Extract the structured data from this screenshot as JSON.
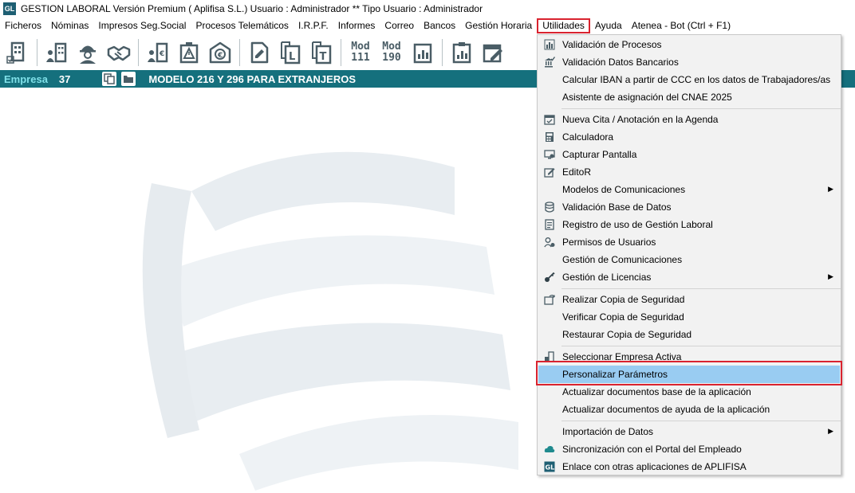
{
  "window": {
    "app_icon_text": "GL",
    "title": "GESTION LABORAL Versión Premium ( Aplifisa S.L.)   Usuario : Administrador  **  Tipo Usuario : Administrador"
  },
  "menubar": {
    "items": [
      "Ficheros",
      "Nóminas",
      "Impresos Seg.Social",
      "Procesos Telemáticos",
      "I.R.P.F.",
      "Informes",
      "Correo",
      "Bancos",
      "Gestión Horaria",
      "Utilidades",
      "Ayuda",
      "Atenea - Bot (Ctrl + F1)"
    ],
    "active": "Utilidades"
  },
  "toolbar": {
    "mod111_top": "Mod",
    "mod111_bottom": "111",
    "mod190_top": "Mod",
    "mod190_bottom": "190"
  },
  "empresa_bar": {
    "label": "Empresa",
    "number": "37",
    "modelo": "MODELO 216 Y 296 PARA EXTRANJEROS"
  },
  "utilidades_menu": {
    "items": [
      "Validación de Procesos",
      "Validación Datos Bancarios",
      "Calcular IBAN a partir de CCC en los datos de Trabajadores/as",
      "Asistente de asignación del CNAE 2025",
      "Nueva Cita / Anotación en la Agenda",
      "Calculadora",
      "Capturar Pantalla",
      "EditoR",
      "Modelos de Comunicaciones",
      "Validación Base de Datos",
      "Registro de uso de Gestión Laboral",
      "Permisos de Usuarios",
      "Gestión de Comunicaciones",
      "Gestión de Licencias",
      "Realizar Copia de Seguridad",
      "Verificar Copia de Seguridad",
      "Restaurar Copia de Seguridad",
      "Seleccionar Empresa Activa",
      "Personalizar Parámetros",
      "Actualizar documentos base de la aplicación",
      "Actualizar documentos de ayuda de la aplicación",
      "Importación de Datos",
      "Sincronización con el Portal del Empleado",
      "Enlace con otras aplicaciones de APLIFISA"
    ],
    "highlighted": "Personalizar Parámetros"
  },
  "colors": {
    "empresa_bar": "#15707d",
    "highlight": "#99ccf2",
    "outline_red": "#d9232f",
    "menu_bg": "#f2f2f2"
  }
}
